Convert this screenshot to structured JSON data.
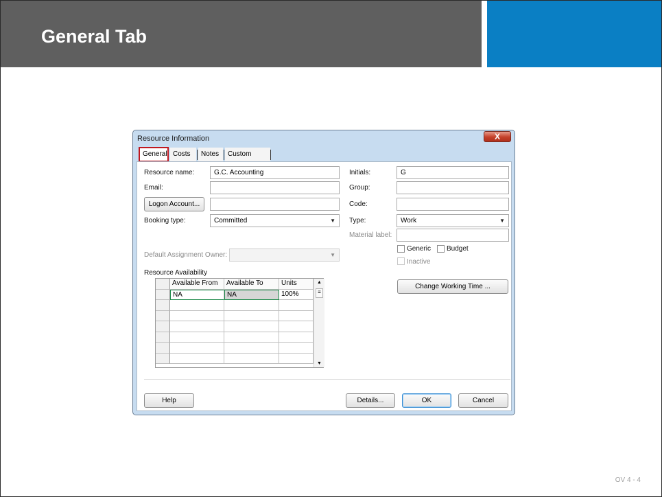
{
  "slide": {
    "title": "General Tab",
    "footer": "OV 4 - 4"
  },
  "dialog": {
    "title": "Resource Information",
    "close_glyph": "X",
    "tabs": [
      "General",
      "Costs",
      "Notes",
      "Custom Fields"
    ],
    "active_tab": "General",
    "resource_name_label": "Resource name:",
    "resource_name_value": "G.C. Accounting",
    "email_label": "Email:",
    "email_value": "",
    "logon_button": "Logon Account...",
    "logon_value": "",
    "booking_type_label": "Booking type:",
    "booking_type_value": "Committed",
    "default_owner_label": "Default Assignment Owner:",
    "default_owner_value": "",
    "initials_label": "Initials:",
    "initials_value": "G",
    "group_label": "Group:",
    "group_value": "",
    "code_label": "Code:",
    "code_value": "",
    "type_label": "Type:",
    "type_value": "Work",
    "material_label_label": "Material label:",
    "material_label_value": "",
    "generic_label": "Generic",
    "budget_label": "Budget",
    "inactive_label": "Inactive",
    "change_working_time_button": "Change Working Time ...",
    "availability": {
      "section_label": "Resource Availability",
      "columns": [
        "Available From",
        "Available To",
        "Units"
      ],
      "rows": [
        [
          "NA",
          "NA",
          "100%"
        ]
      ]
    },
    "help_button": "Help",
    "details_button": "Details...",
    "ok_button": "OK",
    "cancel_button": "Cancel"
  }
}
